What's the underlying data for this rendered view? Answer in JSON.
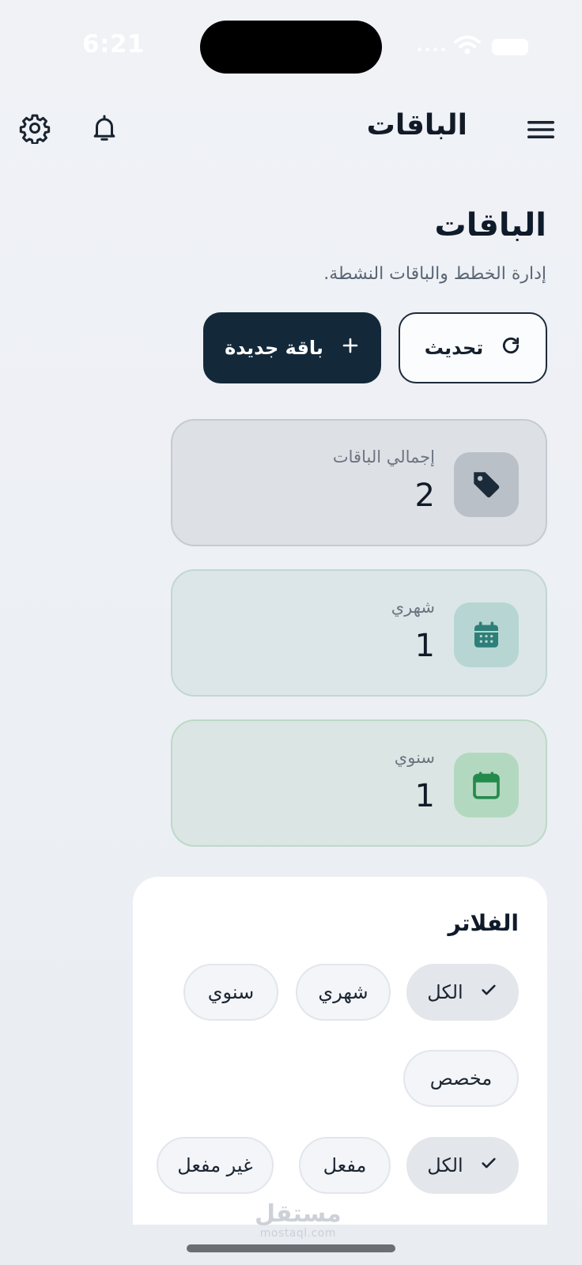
{
  "status": {
    "time": "6:21"
  },
  "topbar": {
    "title": "الباقات",
    "menu_icon": "menu-icon",
    "notifications_icon": "bell-icon",
    "settings_icon": "gear-icon"
  },
  "header": {
    "title": "الباقات",
    "subtitle": "إدارة الخطط والباقات النشطة."
  },
  "actions": {
    "refresh_label": "تحديث",
    "new_label": "باقة جديدة"
  },
  "stats": {
    "total": {
      "label": "إجمالي الباقات",
      "value": "2",
      "icon": "tag-icon",
      "color": "#1c2b3a"
    },
    "monthly": {
      "label": "شهري",
      "value": "1",
      "icon": "calendar-grid-icon",
      "color": "#2e7f78"
    },
    "yearly": {
      "label": "سنوي",
      "value": "1",
      "icon": "calendar-icon",
      "color": "#248a4c"
    }
  },
  "filters": {
    "title": "الفلاتر",
    "period_chips": [
      {
        "label": "الكل",
        "selected": true
      },
      {
        "label": "شهري",
        "selected": false
      },
      {
        "label": "سنوي",
        "selected": false
      },
      {
        "label": "مخصص",
        "selected": false
      }
    ],
    "status_chips": [
      {
        "label": "الكل",
        "selected": true
      },
      {
        "label": "مفعل",
        "selected": false
      },
      {
        "label": "غير مفعل",
        "selected": false
      }
    ]
  },
  "watermark": {
    "arabic": "مستقل",
    "latin": "mostaql.com"
  },
  "colors": {
    "primary": "#13293a",
    "background": "#eef1f5",
    "card": "#ffffff"
  }
}
